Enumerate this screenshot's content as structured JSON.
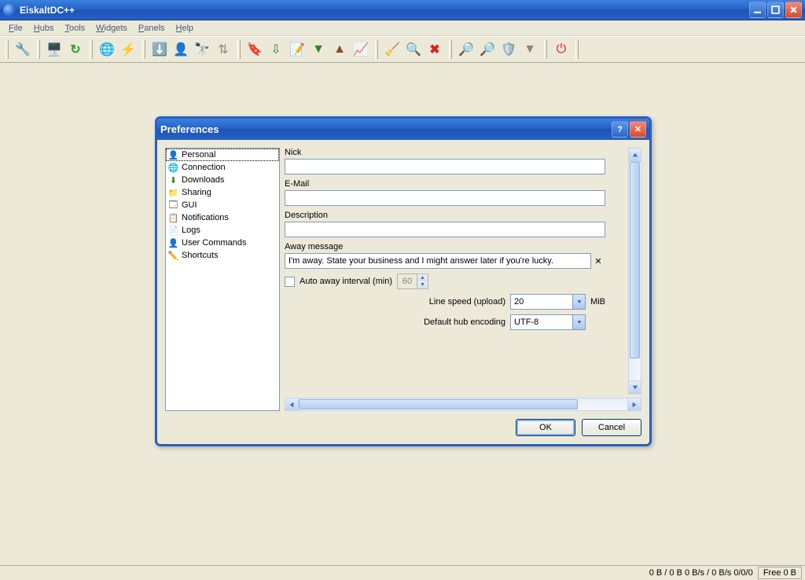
{
  "window": {
    "title": "EiskaltDC++"
  },
  "menus": [
    "File",
    "Hubs",
    "Tools",
    "Widgets",
    "Panels",
    "Help"
  ],
  "toolbar_icons": [
    "tools-icon",
    "screwdriver-icon",
    "refresh-icon",
    "",
    "globe-icon",
    "bolt-icon",
    "",
    "download-icon",
    "user-icon",
    "binoculars-icon",
    "sort-icon",
    "",
    "star-add-icon",
    "import-icon",
    "note-icon",
    "down-arrow-icon",
    "hat-icon",
    "speed-icon",
    "",
    "broom-icon",
    "search-icon",
    "delete-icon",
    "",
    "zoom-in-icon",
    "zoom-out-icon",
    "shield-icon",
    "filter-icon",
    "",
    "power-icon"
  ],
  "dialog": {
    "title": "Preferences",
    "help_label": "?",
    "close_label": "✕",
    "categories": [
      {
        "icon": "user-icon",
        "label": "Personal",
        "selected": true
      },
      {
        "icon": "globe-icon",
        "label": "Connection"
      },
      {
        "icon": "download-icon",
        "label": "Downloads"
      },
      {
        "icon": "folder-icon",
        "label": "Sharing"
      },
      {
        "icon": "window-icon",
        "label": "GUI"
      },
      {
        "icon": "mail-icon",
        "label": "Notifications"
      },
      {
        "icon": "page-icon",
        "label": "Logs"
      },
      {
        "icon": "user-icon",
        "label": "User Commands"
      },
      {
        "icon": "pencil-icon",
        "label": "Shortcuts"
      }
    ],
    "fields": {
      "nick_label": "Nick",
      "nick_value": "",
      "email_label": "E-Mail",
      "email_value": "",
      "description_label": "Description",
      "description_value": "",
      "away_label": "Away message",
      "away_value": "I'm away. State your business and I might answer later if you're lucky.",
      "auto_away_label": "Auto away interval (min)",
      "auto_away_value": "60",
      "line_speed_label": "Line speed (upload)",
      "line_speed_value": "20",
      "line_speed_unit": "MiB",
      "encoding_label": "Default hub encoding",
      "encoding_value": "UTF-8"
    },
    "buttons": {
      "ok": "OK",
      "cancel": "Cancel"
    }
  },
  "statusbar": {
    "stats": "0 B / 0 B  0 B/s / 0 B/s  0/0/0",
    "free": "Free 0 B"
  }
}
